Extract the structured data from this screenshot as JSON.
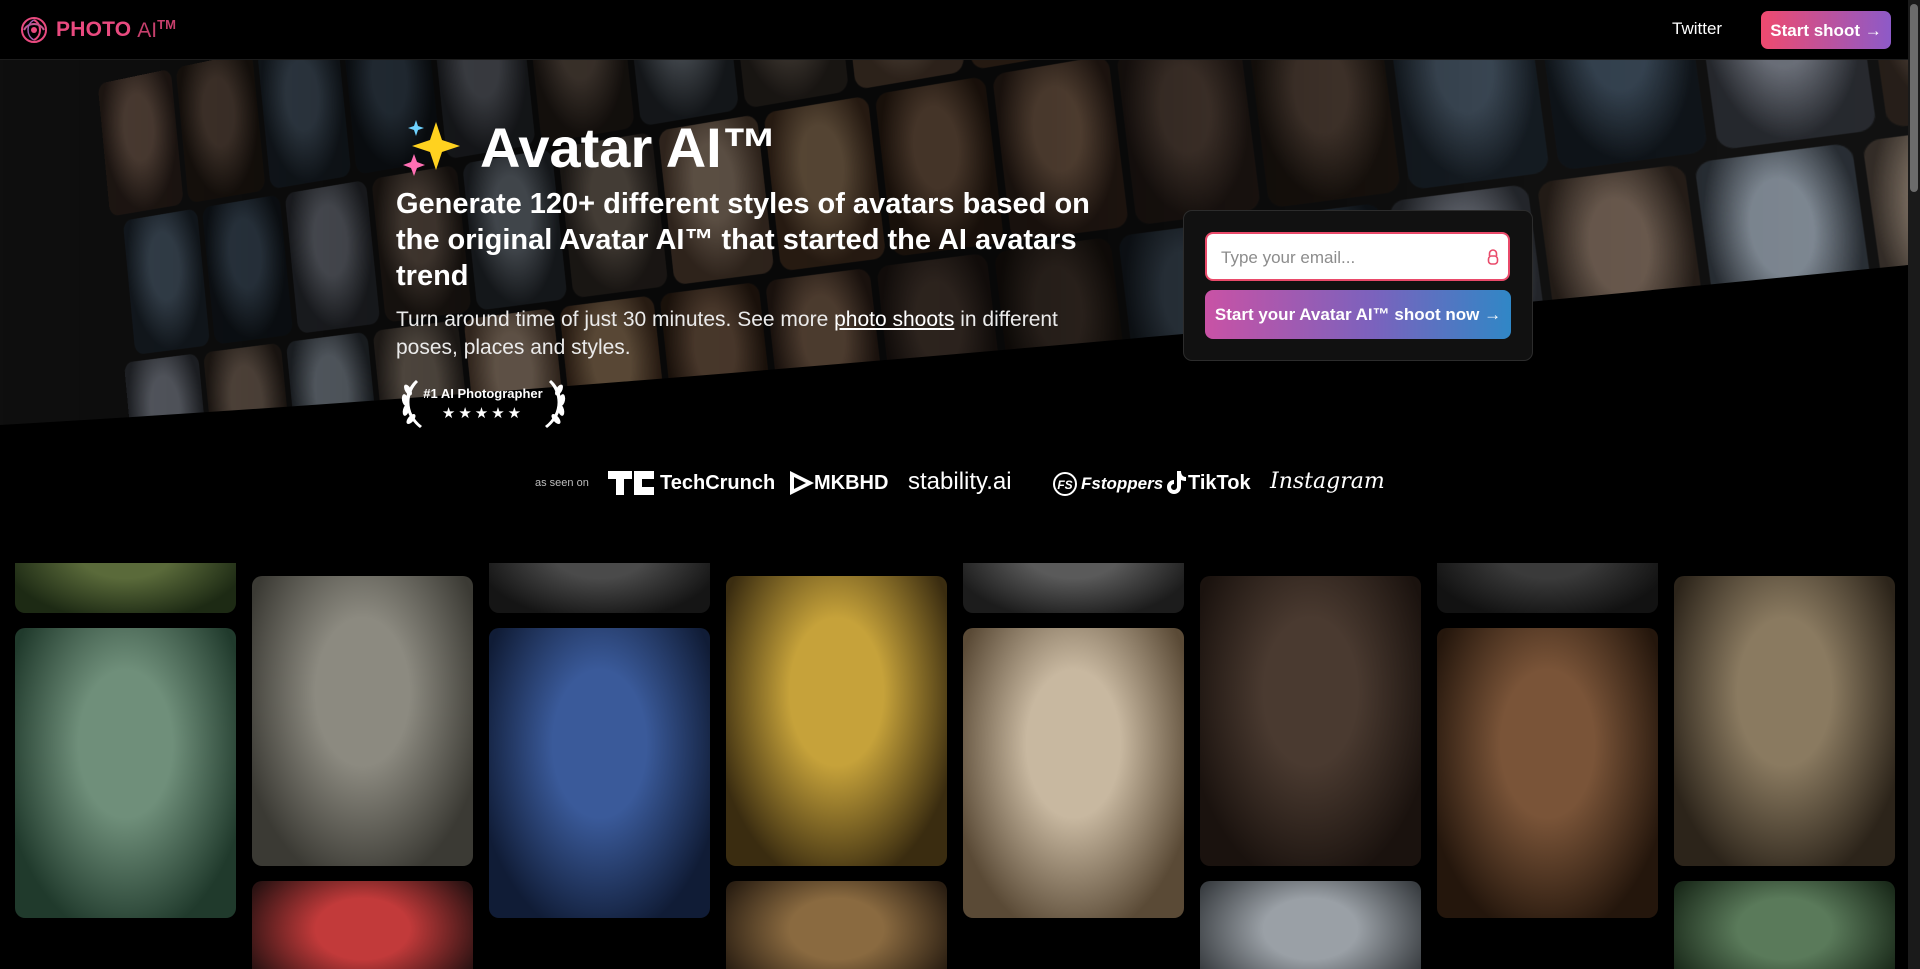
{
  "nav": {
    "brand_photo": "PHOTO",
    "brand_ai": "AI",
    "brand_tm": "TM",
    "twitter": "Twitter",
    "start": "Start shoot →"
  },
  "hero": {
    "title": "Avatar AI™",
    "subtitle": "Generate 120+ different styles of avatars based on the original Avatar AI™ that started the AI avatars trend",
    "desc_before": "Turn around time of just 30 minutes. See more ",
    "desc_link": "photo shoots",
    "desc_after": " in different poses, places and styles.",
    "award_title": "#1 AI Photographer",
    "award_stars": "★★★★★"
  },
  "signup": {
    "email_placeholder": "Type your email...",
    "button": "Start your Avatar AI™ shoot now →"
  },
  "seen_on": {
    "label": "as seen on",
    "brands": [
      "TechCrunch",
      "MKBHD",
      "stability.ai",
      "Fstoppers",
      "TikTok",
      "Instagram"
    ]
  },
  "colors": {
    "brand": "#e94a7f",
    "accent_start": "#ef4a6f",
    "accent_end": "#8d5ac8",
    "email_border": "#e94a6a"
  },
  "icons": [
    "logo-swirl-icon",
    "sparkles-icon",
    "lock-icon",
    "laurel-icon",
    "techcrunch-icon",
    "mkbhd-icon",
    "fstoppers-icon",
    "tiktok-icon"
  ]
}
